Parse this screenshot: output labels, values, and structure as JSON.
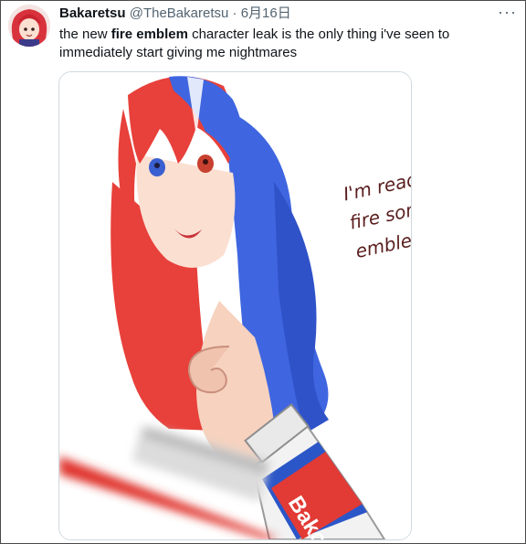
{
  "tweet": {
    "display_name": "Bakaretsu",
    "handle": "@TheBakaretsu",
    "separator": "·",
    "date": "6月16日",
    "more_label": "···",
    "text_before": "the new ",
    "text_bold": "fire emblem",
    "text_after": " character leak is the only thing i've seen to immediately start giving me nightmares"
  },
  "media": {
    "caption_line1": "I'm ready to",
    "caption_line2": "fire some",
    "caption_line3": "emblems!",
    "toothpaste_brand": "Bako"
  },
  "colors": {
    "hair_red": "#e8403a",
    "hair_blue": "#3f66e0",
    "skin": "#f6d2bf",
    "border": "#cfd9de"
  }
}
